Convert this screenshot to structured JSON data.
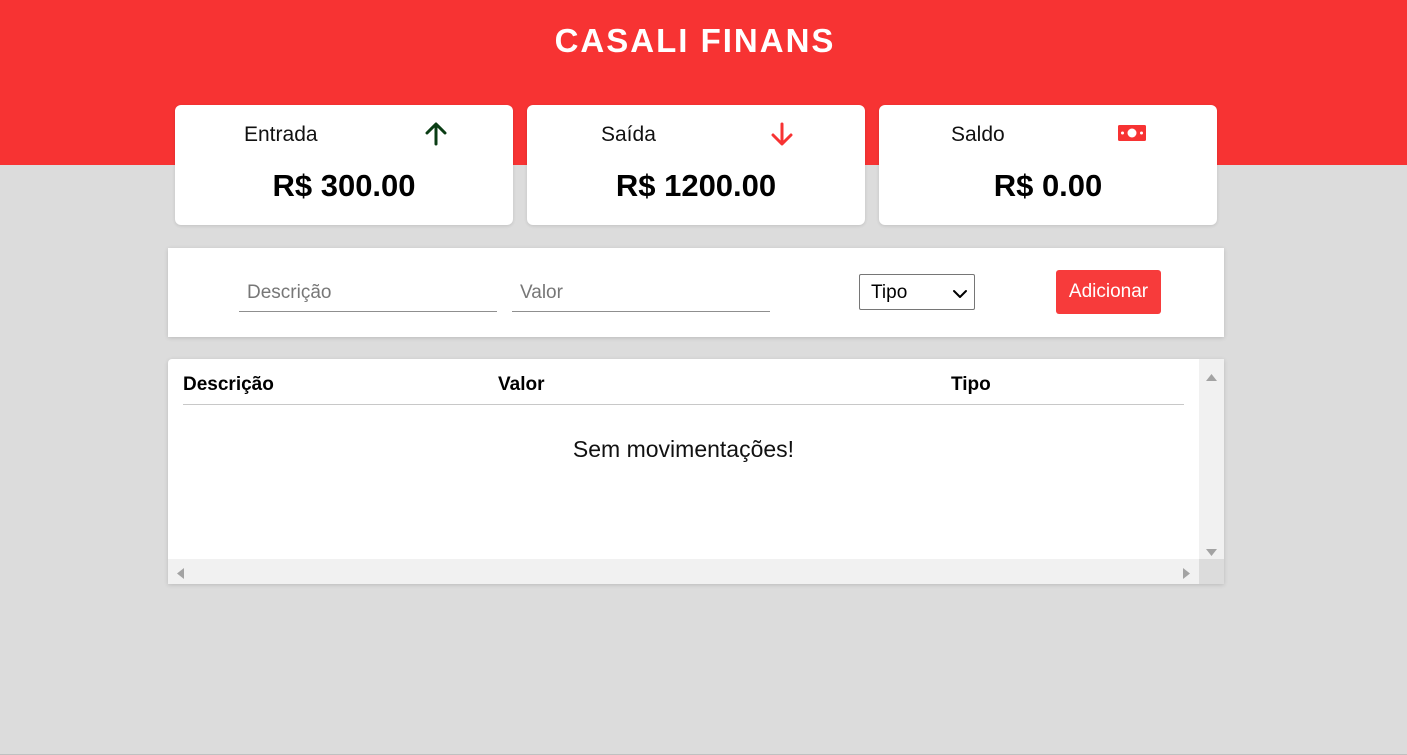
{
  "app": {
    "title": "CASALI FINANS"
  },
  "cards": {
    "income": {
      "label": "Entrada",
      "value": "R$ 300.00",
      "icon": "arrow-up-icon",
      "icon_color": "#0a3d14"
    },
    "expense": {
      "label": "Saída",
      "value": "R$ 1200.00",
      "icon": "arrow-down-icon",
      "icon_color": "#f73333"
    },
    "balance": {
      "label": "Saldo",
      "value": "R$ 0.00",
      "icon": "money-bill-icon",
      "icon_color": "#f73333"
    }
  },
  "form": {
    "description_placeholder": "Descrição",
    "value_placeholder": "Valor",
    "type_select": {
      "selected": "Tipo"
    },
    "add_label": "Adicionar"
  },
  "table": {
    "columns": [
      "Descrição",
      "Valor",
      "Tipo"
    ],
    "empty_message": "Sem movimentações!"
  },
  "colors": {
    "brand": "#f73333",
    "background": "#dcdcdc",
    "button": "#f73b3b"
  }
}
